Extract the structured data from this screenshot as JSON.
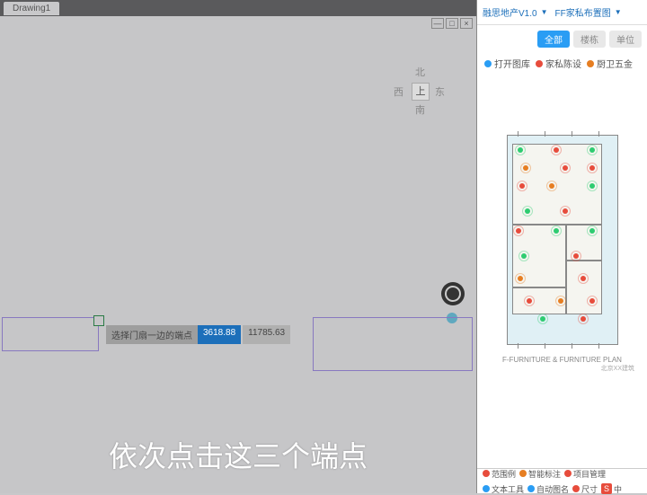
{
  "titlebar": {
    "tab": "Drawing1"
  },
  "wincontrols": {
    "min": "—",
    "max": "□",
    "close": "×"
  },
  "compass": {
    "n": "北",
    "s": "南",
    "e": "东",
    "w": "西",
    "c": "上"
  },
  "prompt": {
    "label": "选择门扇一边的端点",
    "val1": "3618.88",
    "val2": "11785.63"
  },
  "panel": {
    "title": "融思地产V1.0",
    "dropdown": "FF家私布置图",
    "pills": {
      "all": "全部",
      "p1": "楼栋",
      "p2": "单位"
    },
    "legend": {
      "l1": "打开图库",
      "l2": "家私陈设",
      "l3": "厨卫五金"
    },
    "legend2_row1": {
      "a": "范围例",
      "b": "智能标注",
      "c": "项目管理",
      "d": "文本工具"
    },
    "legend2_row2": {
      "a": "自动图名",
      "b": "尺寸",
      "c": "中",
      "d": "○"
    },
    "fptitle": "F-FURNITURE & FURNITURE PLAN",
    "fpbrand": "北京XX建筑"
  },
  "overlay": "依次点击这三个端点"
}
